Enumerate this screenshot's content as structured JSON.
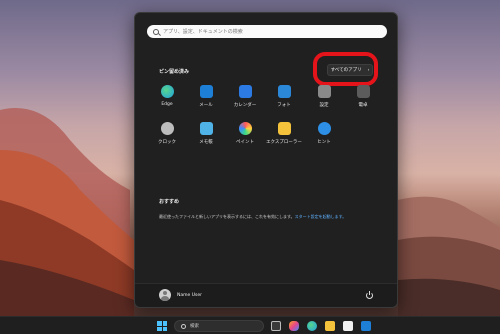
{
  "start_menu": {
    "search_placeholder": "アプリ、設定、ドキュメントの検索",
    "pinned_title": "ピン留め済み",
    "all_apps_label": "すべてのアプリ",
    "all_apps_chevron": "›",
    "pinned_apps": [
      {
        "label": "Edge",
        "icon": "edge-icon",
        "color": "#1fa0e0"
      },
      {
        "label": "メール",
        "icon": "mail-icon",
        "color": "#1e7fd6"
      },
      {
        "label": "カレンダー",
        "icon": "calendar-icon",
        "color": "#2c7be5"
      },
      {
        "label": "フォト",
        "icon": "photos-icon",
        "color": "#2b88d8"
      },
      {
        "label": "設定",
        "icon": "settings-icon",
        "color": "#8a8a8a"
      },
      {
        "label": "電卓",
        "icon": "calculator-icon",
        "color": "#5c5c5c"
      },
      {
        "label": "クロック",
        "icon": "clock-icon",
        "color": "#bdbdbd"
      },
      {
        "label": "メモ帳",
        "icon": "notepad-icon",
        "color": "#4fb3e8"
      },
      {
        "label": "ペイント",
        "icon": "paint-icon",
        "color": "#ffffff"
      },
      {
        "label": "エクスプローラー",
        "icon": "file-explorer-icon",
        "color": "#f5c23c"
      },
      {
        "label": "ヒント",
        "icon": "tips-icon",
        "color": "#2d8fe6"
      }
    ],
    "recommended_title": "おすすめ",
    "recommended_text": "最近使ったファイルと新しいアプリを表示するには、これを有効にします。",
    "recommended_link": "スタート設定を起動します。",
    "user_name": "Name User"
  },
  "taskbar": {
    "search_placeholder": "検索",
    "icons": [
      "windows-start-icon",
      "task-view-icon",
      "copilot-icon",
      "edge-icon",
      "file-explorer-icon",
      "store-icon",
      "mail-icon"
    ]
  },
  "colors": {
    "highlight": "#e5141b",
    "link": "#5fb2ff",
    "accent": "#4cc2ff"
  }
}
